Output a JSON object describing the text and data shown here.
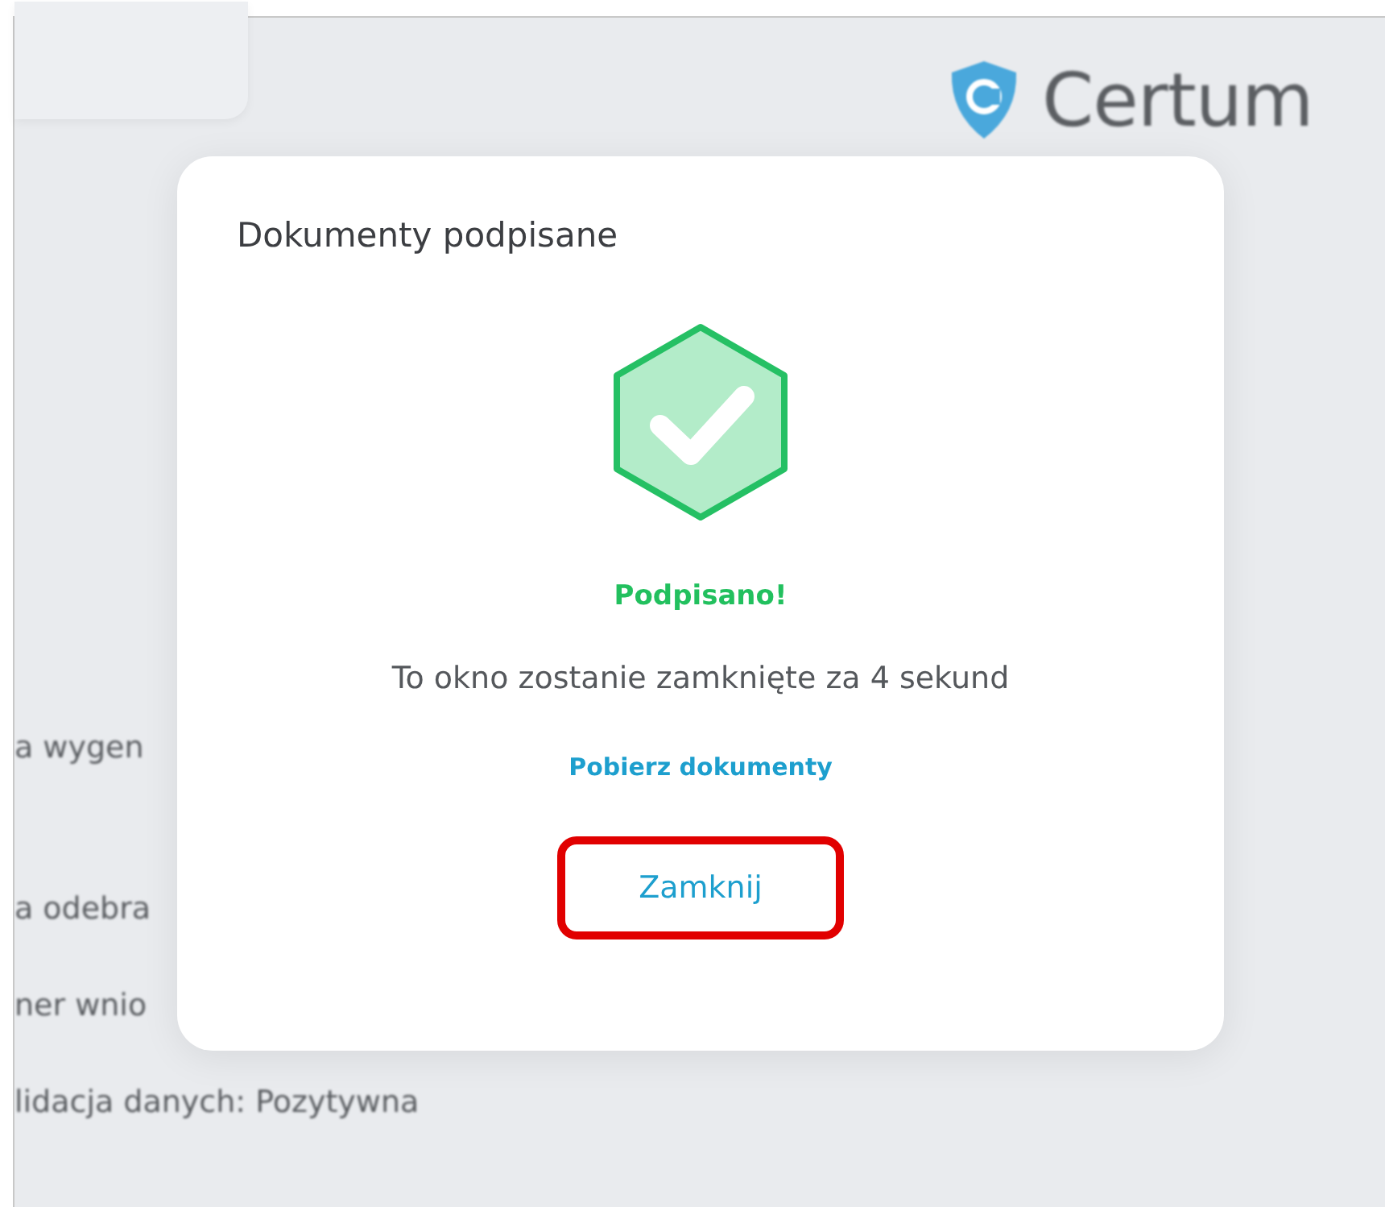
{
  "background": {
    "logo": "Certum",
    "lines": [
      "a wygen",
      "a odebra",
      "ner wnio",
      "lidacja danych: Pozytywna"
    ]
  },
  "dialog": {
    "title": "Dokumenty podpisane",
    "status": "Podpisano!",
    "message": "To okno zostanie zamknięte za 4 sekund",
    "download_link": "Pobierz dokumenty",
    "close_button": {
      "label": "Zamknij",
      "highlighted": true
    }
  }
}
